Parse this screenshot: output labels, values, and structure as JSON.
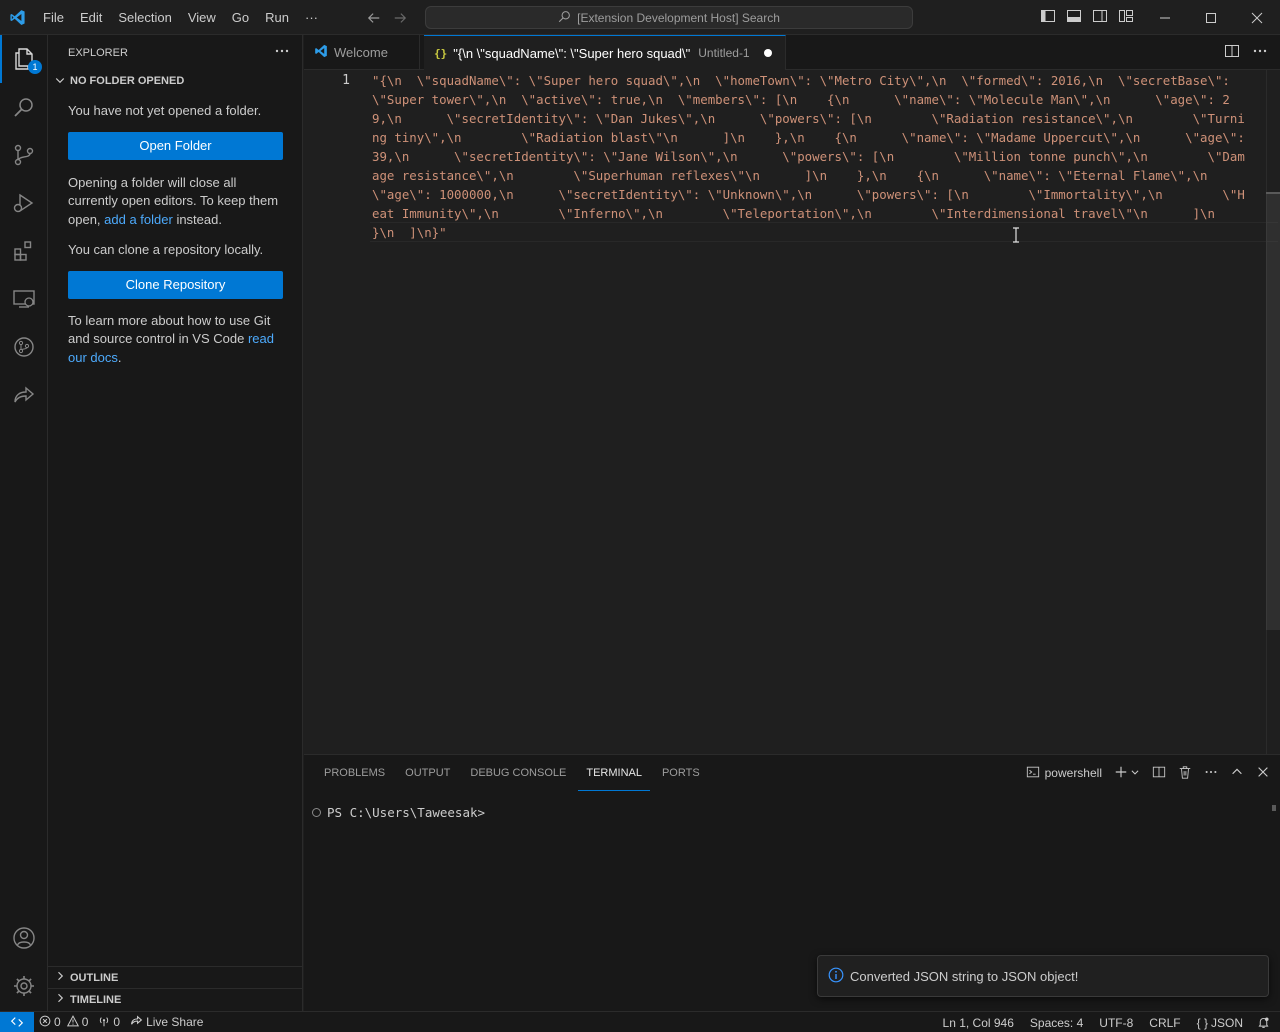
{
  "titlebar": {
    "menu": [
      "File",
      "Edit",
      "Selection",
      "View",
      "Go",
      "Run"
    ],
    "more": "···",
    "search": "[Extension Development Host] Search"
  },
  "activity": {
    "explorer_badge": "1",
    "items": [
      "explorer-icon",
      "search-icon",
      "source-control-icon",
      "run-debug-icon",
      "extensions-icon",
      "remote-explorer-icon",
      "github-icon",
      "live-share-icon",
      "accounts-icon",
      "manage-gear-icon"
    ]
  },
  "sidebar": {
    "title": "EXPLORER",
    "section": "NO FOLDER OPENED",
    "text1": "You have not yet opened a folder.",
    "open_folder": "Open Folder",
    "text2_a": "Opening a folder will close all currently open editors. To keep them open, ",
    "text2_link": "add a folder",
    "text2_b": " instead.",
    "text3": "You can clone a repository locally.",
    "clone": "Clone Repository",
    "text4_a": "To learn more about how to use Git and source control in VS Code ",
    "text4_link": "read our docs",
    "text4_b": ".",
    "outline": "OUTLINE",
    "timeline": "TIMELINE"
  },
  "tabs": [
    {
      "label": "Welcome",
      "icon": "vscode-logo-icon"
    },
    {
      "label": "\"{\\n \\\"squadName\\\": \\\"Super hero squad\\\"",
      "description": "Untitled-1",
      "icon": "json-braces-icon",
      "dirty": true
    }
  ],
  "editor": {
    "line_numbers": [
      "1"
    ],
    "content": "\"{\\n  \\\"squadName\\\": \\\"Super hero squad\\\",\\n  \\\"homeTown\\\": \\\"Metro City\\\",\\n  \\\"formed\\\": 2016,\\n  \\\"secretBase\\\": \\\"Super tower\\\",\\n  \\\"active\\\": true,\\n  \\\"members\\\": [\\n    {\\n      \\\"name\\\": \\\"Molecule Man\\\",\\n      \\\"age\\\": 29,\\n      \\\"secretIdentity\\\": \\\"Dan Jukes\\\",\\n      \\\"powers\\\": [\\n        \\\"Radiation resistance\\\",\\n        \\\"Turning tiny\\\",\\n        \\\"Radiation blast\\\"\\n      ]\\n    },\\n    {\\n      \\\"name\\\": \\\"Madame Uppercut\\\",\\n      \\\"age\\\": 39,\\n      \\\"secretIdentity\\\": \\\"Jane Wilson\\\",\\n      \\\"powers\\\": [\\n        \\\"Million tonne punch\\\",\\n        \\\"Damage resistance\\\",\\n        \\\"Superhuman reflexes\\\"\\n      ]\\n    },\\n    {\\n      \\\"name\\\": \\\"Eternal Flame\\\",\\n      \\\"age\\\": 1000000,\\n      \\\"secretIdentity\\\": \\\"Unknown\\\",\\n      \\\"powers\\\": [\\n        \\\"Immortality\\\",\\n        \\\"Heat Immunity\\\",\\n        \\\"Inferno\\\",\\n        \\\"Teleportation\\\",\\n        \\\"Interdimensional travel\\\"\\n      ]\\n    }\\n  ]\\n}\""
  },
  "panel": {
    "tabs": [
      "PROBLEMS",
      "OUTPUT",
      "DEBUG CONSOLE",
      "TERMINAL",
      "PORTS"
    ],
    "active_tab": "TERMINAL",
    "shell": "powershell",
    "prompt": "PS C:\\Users\\Taweesak>"
  },
  "notification": {
    "message": "Converted JSON string to JSON object!"
  },
  "statusbar": {
    "errors": "0",
    "warnings": "0",
    "ports": "0",
    "live_share": "Live Share",
    "position": "Ln 1, Col 946",
    "spaces": "Spaces: 4",
    "encoding": "UTF-8",
    "eol": "CRLF",
    "language": "JSON",
    "language_icon": "{ }"
  },
  "colors": {
    "accent": "#0078d4",
    "string": "#ce9178",
    "link": "#4daafc"
  }
}
